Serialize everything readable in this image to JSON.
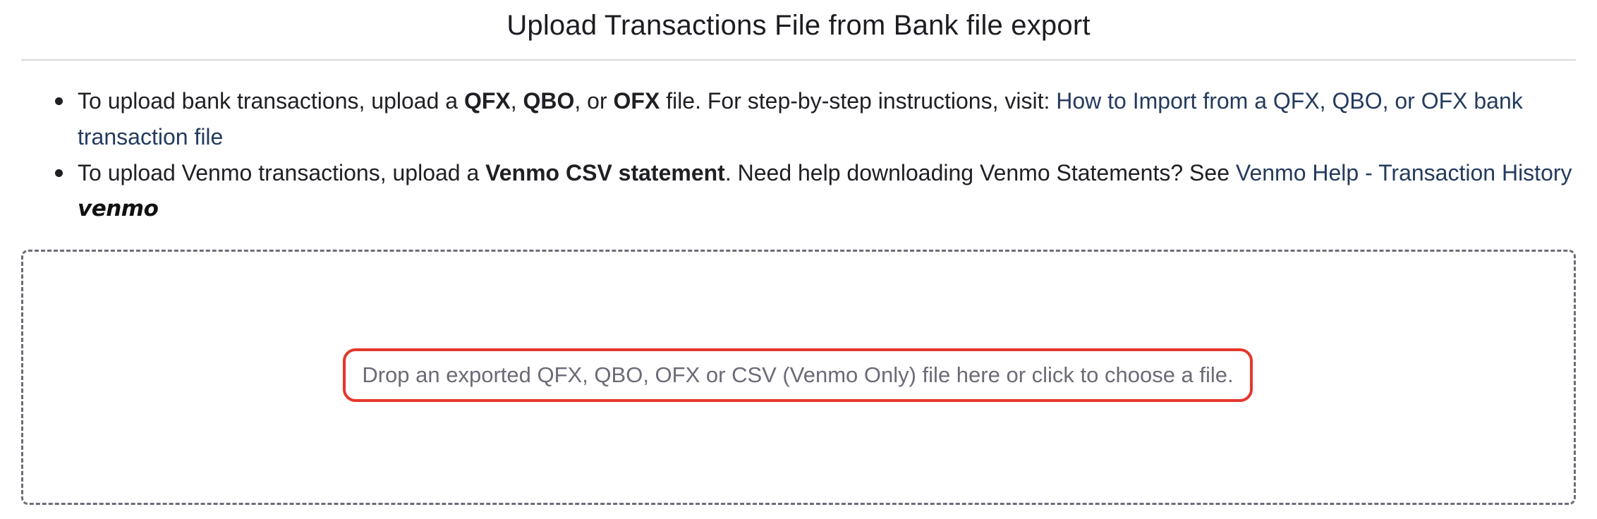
{
  "header": {
    "title": "Upload Transactions File from Bank file export"
  },
  "instructions": [
    {
      "text_1": "To upload bank transactions, upload a ",
      "bold_1": "QFX",
      "sep_1": ", ",
      "bold_2": "QBO",
      "sep_2": ", or ",
      "bold_3": "OFX",
      "text_2": " file. For step-by-step instructions, visit: ",
      "link": "How to Import from a QFX, QBO, or OFX bank transaction file"
    },
    {
      "text_1": "To upload Venmo transactions, upload a ",
      "bold_1": "Venmo CSV statement",
      "text_2": ". Need help downloading Venmo Statements? See ",
      "link": "Venmo Help - Transaction History",
      "logo": "venmo"
    }
  ],
  "dropzone": {
    "label": "Drop an exported QFX, QBO, OFX or CSV (Venmo Only) file here or click to choose a file."
  },
  "colors": {
    "link": "#243b5e",
    "highlight": "#e5372c",
    "dropzone_border": "#6d6d78",
    "dropzone_text": "#6b6b78"
  }
}
